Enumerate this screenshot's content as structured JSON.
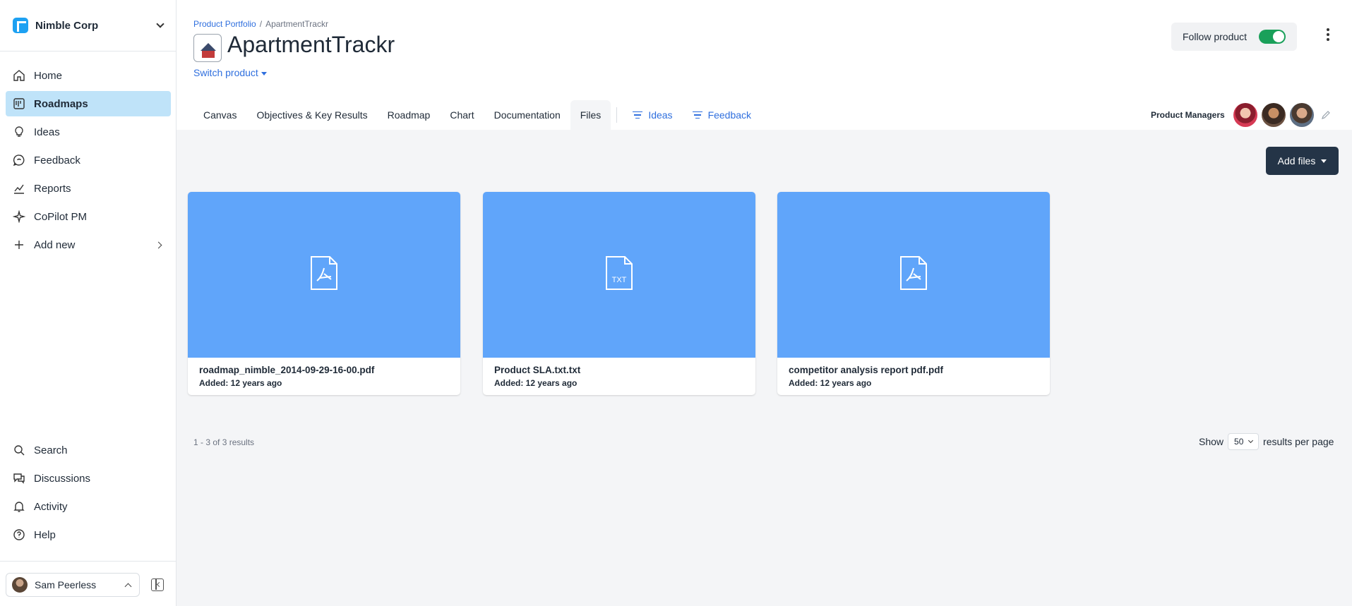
{
  "org": {
    "name": "Nimble Corp"
  },
  "nav": {
    "items": [
      {
        "label": "Home",
        "icon": "home-icon"
      },
      {
        "label": "Roadmaps",
        "icon": "roadmap-icon",
        "active": true
      },
      {
        "label": "Ideas",
        "icon": "lightbulb-icon"
      },
      {
        "label": "Feedback",
        "icon": "feedback-icon"
      },
      {
        "label": "Reports",
        "icon": "chart-icon"
      },
      {
        "label": "CoPilot PM",
        "icon": "sparkle-icon"
      },
      {
        "label": "Add new",
        "icon": "plus-icon"
      }
    ],
    "bottom": [
      {
        "label": "Search",
        "icon": "search-icon"
      },
      {
        "label": "Discussions",
        "icon": "discussion-icon"
      },
      {
        "label": "Activity",
        "icon": "bell-icon"
      },
      {
        "label": "Help",
        "icon": "help-icon"
      }
    ]
  },
  "user": {
    "name": "Sam Peerless"
  },
  "breadcrumb": {
    "parent": "Product Portfolio",
    "separator": "/",
    "current": "ApartmentTrackr"
  },
  "product": {
    "title": "ApartmentTrackr",
    "switch_label": "Switch product"
  },
  "follow": {
    "label": "Follow product",
    "on": true
  },
  "tabs": [
    {
      "label": "Canvas"
    },
    {
      "label": "Objectives & Key Results"
    },
    {
      "label": "Roadmap"
    },
    {
      "label": "Chart"
    },
    {
      "label": "Documentation"
    },
    {
      "label": "Files",
      "active": true
    },
    {
      "label": "Ideas",
      "filter": true
    },
    {
      "label": "Feedback",
      "filter": true
    }
  ],
  "product_managers": {
    "label": "Product Managers"
  },
  "files": {
    "add_label": "Add files",
    "items": [
      {
        "name": "roadmap_nimble_2014-09-29-16-00.pdf",
        "added": "Added: 12 years ago",
        "type": "pdf"
      },
      {
        "name": "Product SLA.txt.txt",
        "added": "Added: 12 years ago",
        "type": "txt"
      },
      {
        "name": "competitor analysis report pdf.pdf",
        "added": "Added: 12 years ago",
        "type": "pdf"
      }
    ]
  },
  "pagination": {
    "summary": "1 - 3 of 3 results",
    "show": "Show",
    "per_page": "50",
    "suffix": "results per page"
  },
  "colors": {
    "accent": "#2f6fde",
    "active_nav": "#bfe3f9",
    "thumb": "#60a5fa",
    "primary_button": "#243447",
    "toggle_on": "#1aa05a"
  }
}
